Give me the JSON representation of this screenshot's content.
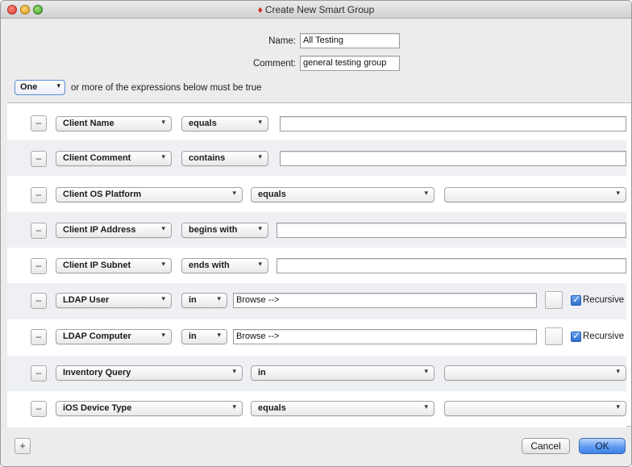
{
  "window": {
    "title": "Create New Smart Group",
    "title_icon": "red-gem-icon"
  },
  "fields": {
    "name_label": "Name:",
    "name_value": "All Testing",
    "comment_label": "Comment:",
    "comment_value": "general testing group"
  },
  "quantifier": {
    "value": "One",
    "text": "or more of the expressions below must be true"
  },
  "rows": [
    {
      "field": "Client Name",
      "op": "equals",
      "value": ""
    },
    {
      "field": "Client Comment",
      "op": "contains",
      "value": ""
    },
    {
      "field": "Client OS Platform",
      "op": "equals",
      "value": ""
    },
    {
      "field": "Client IP Address",
      "op": "begins with",
      "value": ""
    },
    {
      "field": "Client IP Subnet",
      "op": "ends with",
      "value": ""
    },
    {
      "field": "LDAP User",
      "op": "in",
      "value": "Browse -->",
      "recursive_label": "Recursive",
      "recursive_checked": true
    },
    {
      "field": "LDAP Computer",
      "op": "in",
      "value": "Browse -->",
      "recursive_label": "Recursive",
      "recursive_checked": true
    },
    {
      "field": "Inventory Query",
      "op": "in",
      "value": ""
    },
    {
      "field": "iOS Device Type",
      "op": "equals",
      "value": ""
    }
  ],
  "buttons": {
    "minus": "–",
    "add": "+",
    "cancel": "Cancel",
    "ok": "OK"
  },
  "colors": {
    "accent": "#3d82e8",
    "title_icon": "#d2291e"
  }
}
